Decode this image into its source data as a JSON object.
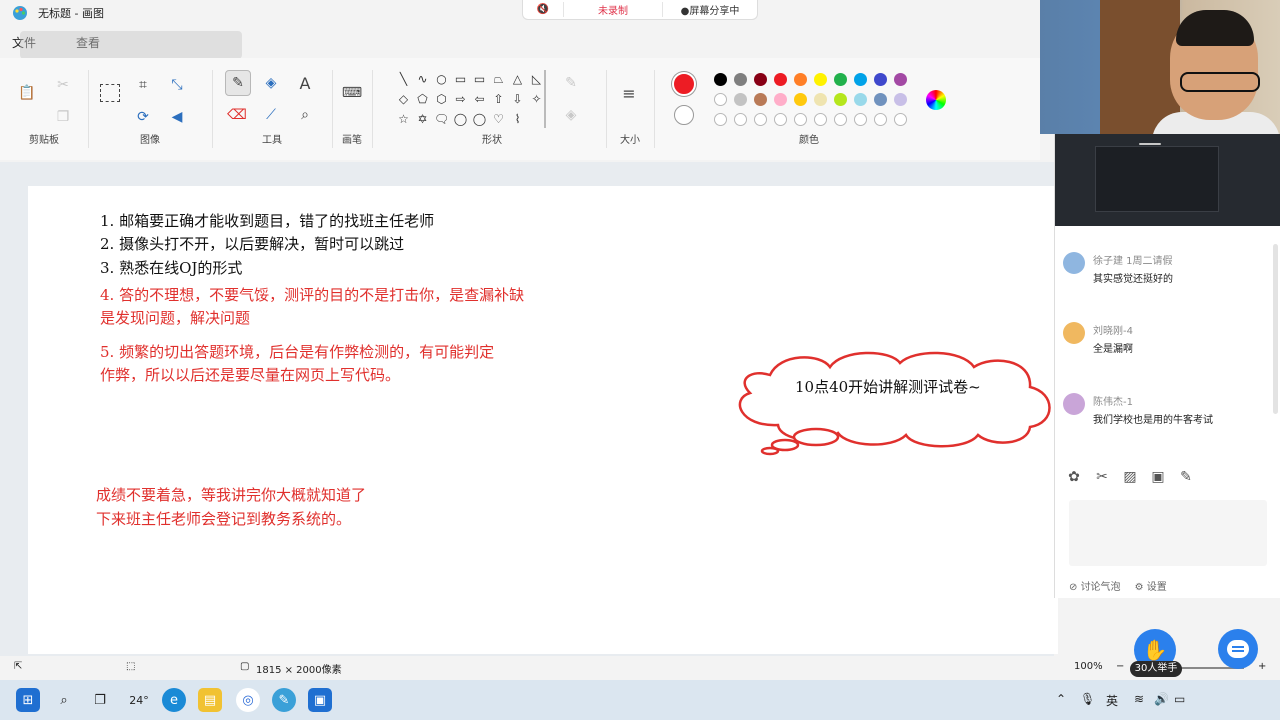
{
  "window": {
    "title": "无标题 - 画图",
    "icon": "paint-app-icon"
  },
  "recording": {
    "mic_icon": "mic-muted-icon",
    "status": "未录制",
    "share": "●屏幕分享中"
  },
  "menu": {
    "file": "文件",
    "view": "查看",
    "overlay_text": ""
  },
  "ribbon": {
    "groups": {
      "clipboard": "剪贴板",
      "image": "图像",
      "tools": "工具",
      "brushes": "画笔",
      "shapes": "形状",
      "size": "大小",
      "colors": "颜色"
    },
    "shapes": [
      "╲",
      "∿",
      "○",
      "▭",
      "▭",
      "⏢",
      "△",
      "◺",
      "◇",
      "⬠",
      "⬡",
      "⇨",
      "⇦",
      "⇧",
      "⇩",
      "✧",
      "☆",
      "✡",
      "🗨",
      "◯",
      "◯",
      "♡",
      "⌇",
      ""
    ],
    "palette_row1": [
      "#000000",
      "#7f7f7f",
      "#880015",
      "#ed1c24",
      "#ff7f27",
      "#fff200",
      "#22b14c",
      "#00a2e8",
      "#3f48cc",
      "#a349a4"
    ],
    "palette_row2": [
      "#ffffff",
      "#c3c3c3",
      "#b97a57",
      "#ffaec9",
      "#ffc90e",
      "#efe4b0",
      "#b5e61d",
      "#99d9ea",
      "#7092be",
      "#c8bfe7"
    ],
    "primary_color": "#ed1c24",
    "secondary_color": "#ffffff"
  },
  "canvas": {
    "notes_black": [
      "1.  邮箱要正确才能收到题目，错了的找班主任老师",
      "2.  摄像头打不开，以后要解决，暂时可以跳过",
      "3.  熟悉在线OJ的形式"
    ],
    "notes_red_4": [
      "4.  答的不理想，不要气馁，测评的目的不是打击你，是查漏补缺",
      "是发现问题，解决问题"
    ],
    "notes_red_5": [
      "5. 频繁的切出答题环境，后台是有作弊检测的，有可能判定",
      "作弊，所以以后还是要尽量在网页上写代码。"
    ],
    "notes_red_bottom": [
      "成绩不要着急，等我讲完你大概就知道了",
      "下来班主任老师会登记到教务系统的。"
    ],
    "cloud_text": "10点40开始讲解测评试卷~"
  },
  "status": {
    "canvas_size": "1815 × 2000像素",
    "zoom": "100%"
  },
  "taskbar": {
    "weather": "24°",
    "ime": "英"
  },
  "chat": {
    "messages": [
      {
        "name": "徐子建 1周二请假",
        "text": "其实感觉还挺好的",
        "avatar_color": "#8fb6e0"
      },
      {
        "name": "刘晓刚-4",
        "text": "全是漏啊",
        "avatar_color": "#f0b860"
      },
      {
        "name": "陈伟杰-1",
        "text": "我们学校也是用的牛客考试",
        "avatar_color": "#c9a5d8"
      }
    ],
    "footer_bubble": "讨论气泡",
    "footer_settings": "设置"
  },
  "floating": {
    "raise_label": "30人举手"
  }
}
